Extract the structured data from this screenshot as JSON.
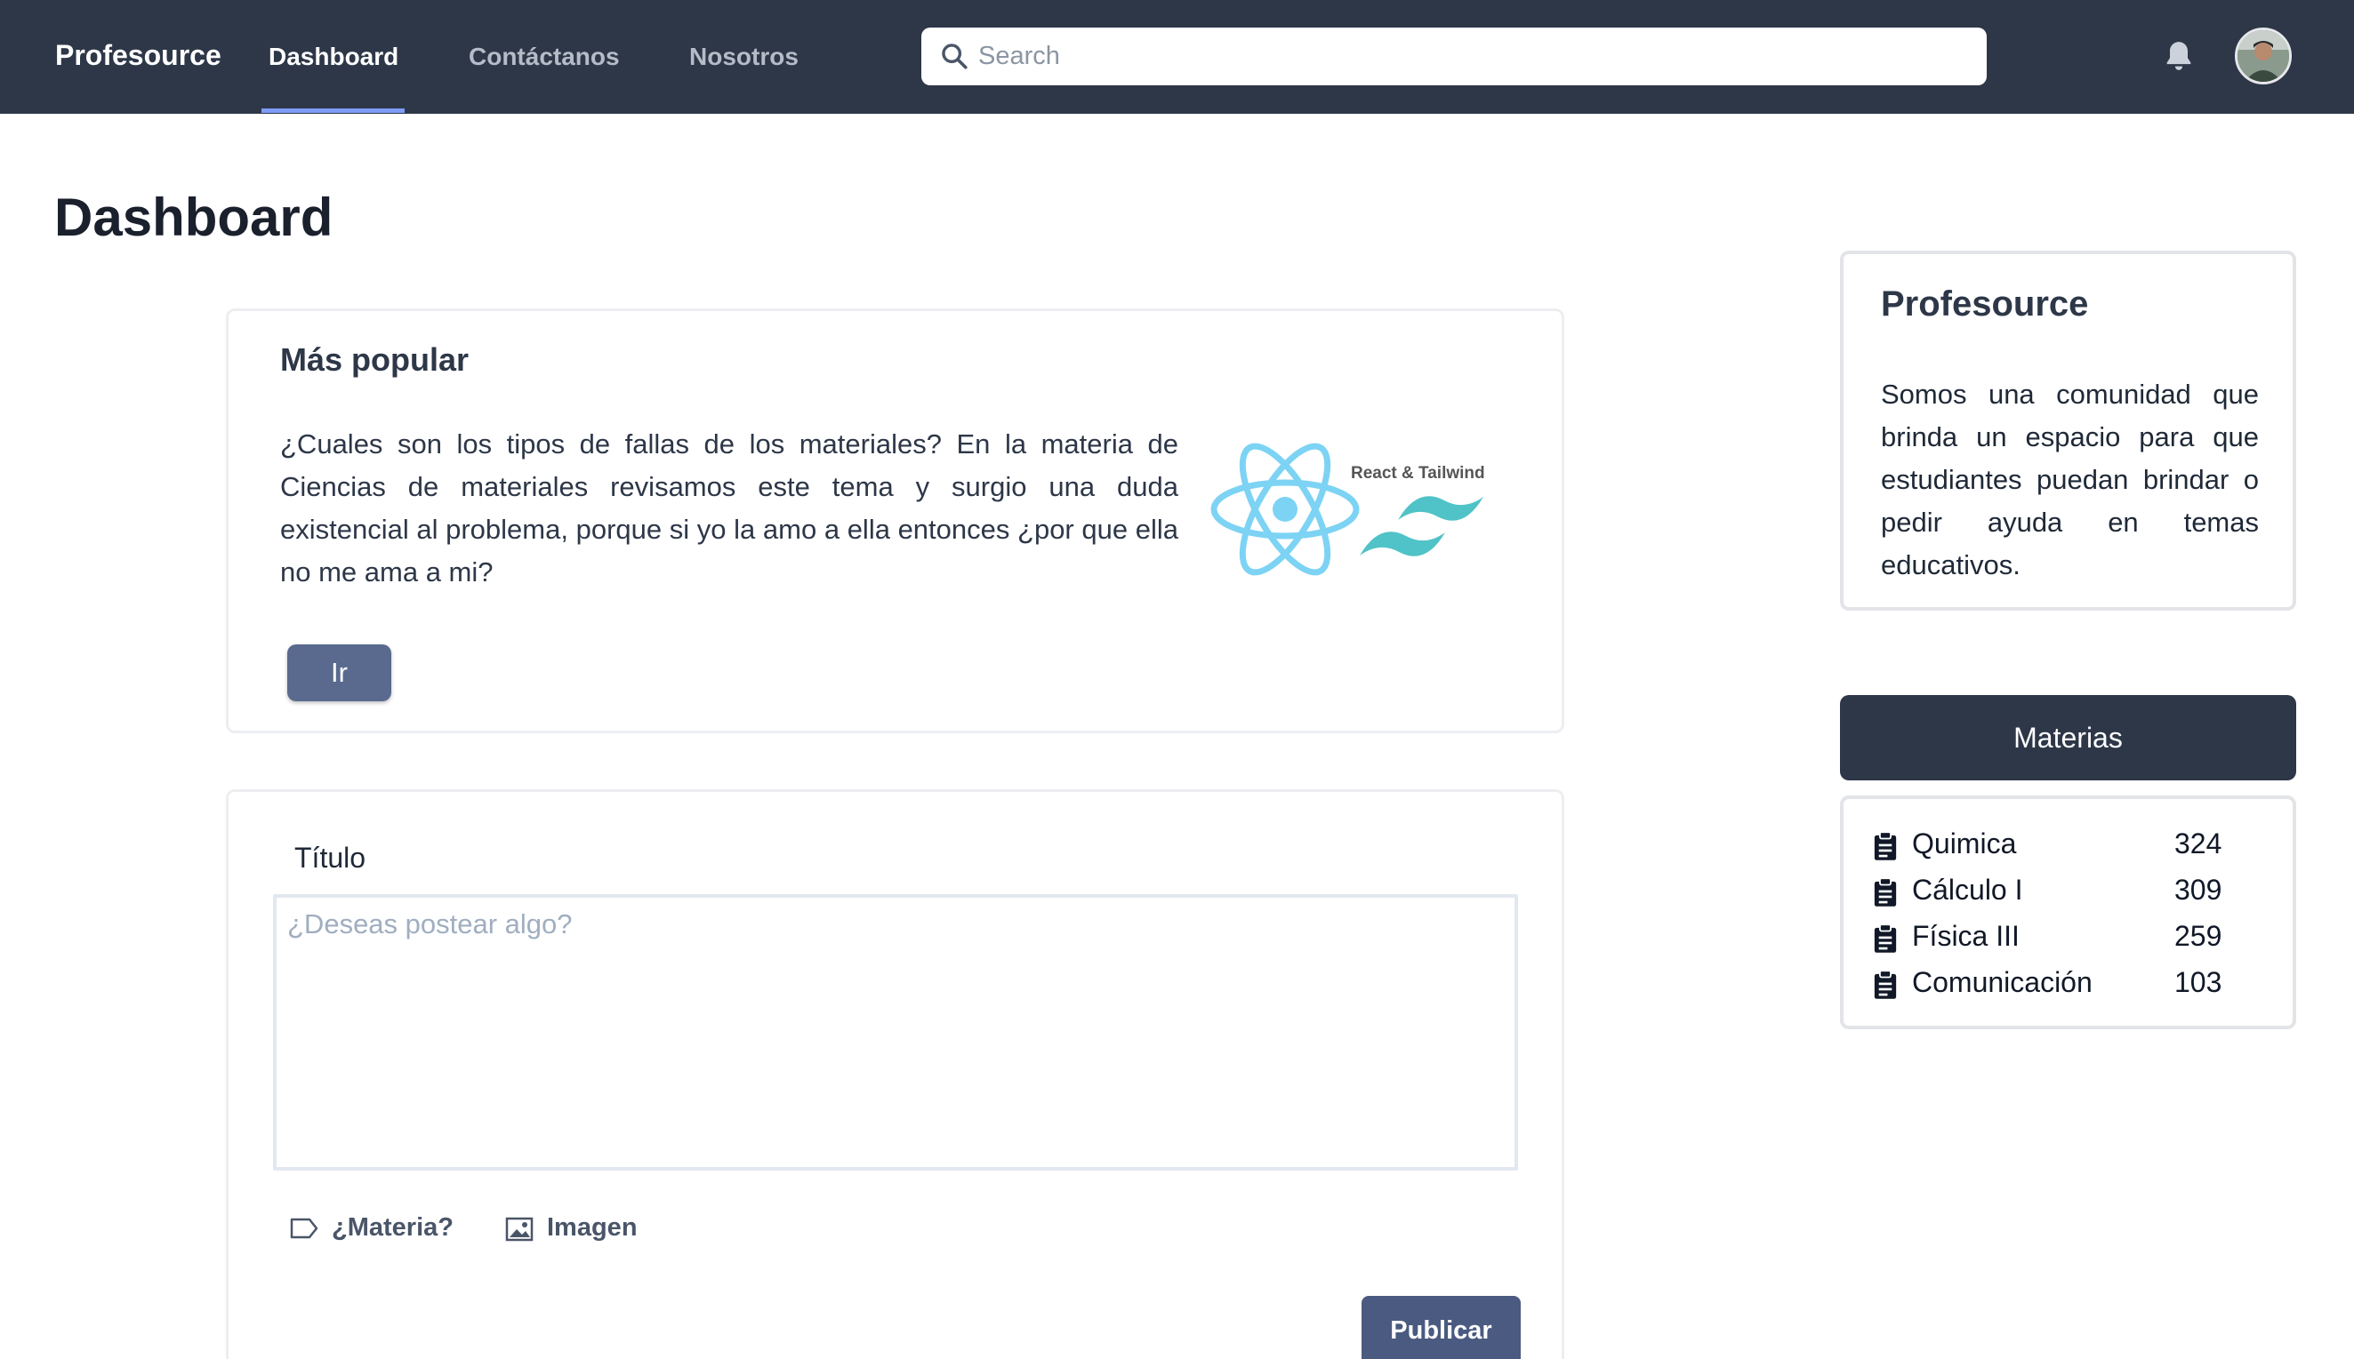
{
  "navbar": {
    "brand": "Profesource",
    "links": [
      {
        "label": "Dashboard",
        "active": true
      },
      {
        "label": "Contáctanos",
        "active": false
      },
      {
        "label": "Nosotros",
        "active": false
      }
    ],
    "search_placeholder": "Search",
    "bell_icon": "bell-icon",
    "search_icon": "search-icon",
    "avatar_icon": "user-avatar"
  },
  "page": {
    "title": "Dashboard"
  },
  "popular": {
    "title": "Más popular",
    "text": "¿Cuales son los tipos de fallas de los materiales? En la materia de Ciencias de materiales revisamos este tema y surgio una duda existencial al problema, porque si yo la amo a ella entonces ¿por que ella no me ama a mi?",
    "image_caption": "React & Tailwind",
    "button_label": "Ir"
  },
  "post": {
    "label": "Título",
    "placeholder": "¿Deseas postear algo?",
    "materia_label": "¿Materia?",
    "materia_icon": "tag-icon",
    "imagen_label": "Imagen",
    "imagen_icon": "image-icon",
    "publish_label": "Publicar"
  },
  "about": {
    "title": "Profesource",
    "text": "Somos una comunidad que brinda un espacio para que estudiantes puedan brindar o pedir ayuda en temas educativos."
  },
  "materias": {
    "header": "Materias",
    "icon": "clipboard-icon",
    "items": [
      {
        "name": "Quimica",
        "count": "324"
      },
      {
        "name": "Cálculo I",
        "count": "309"
      },
      {
        "name": "Física III",
        "count": "259"
      },
      {
        "name": "Comunicación",
        "count": "103"
      }
    ]
  },
  "colors": {
    "navbar_bg": "#2d3748",
    "accent": "#7f9cf5",
    "button": "#5a6a8f",
    "publish_button": "#4a5a80"
  }
}
